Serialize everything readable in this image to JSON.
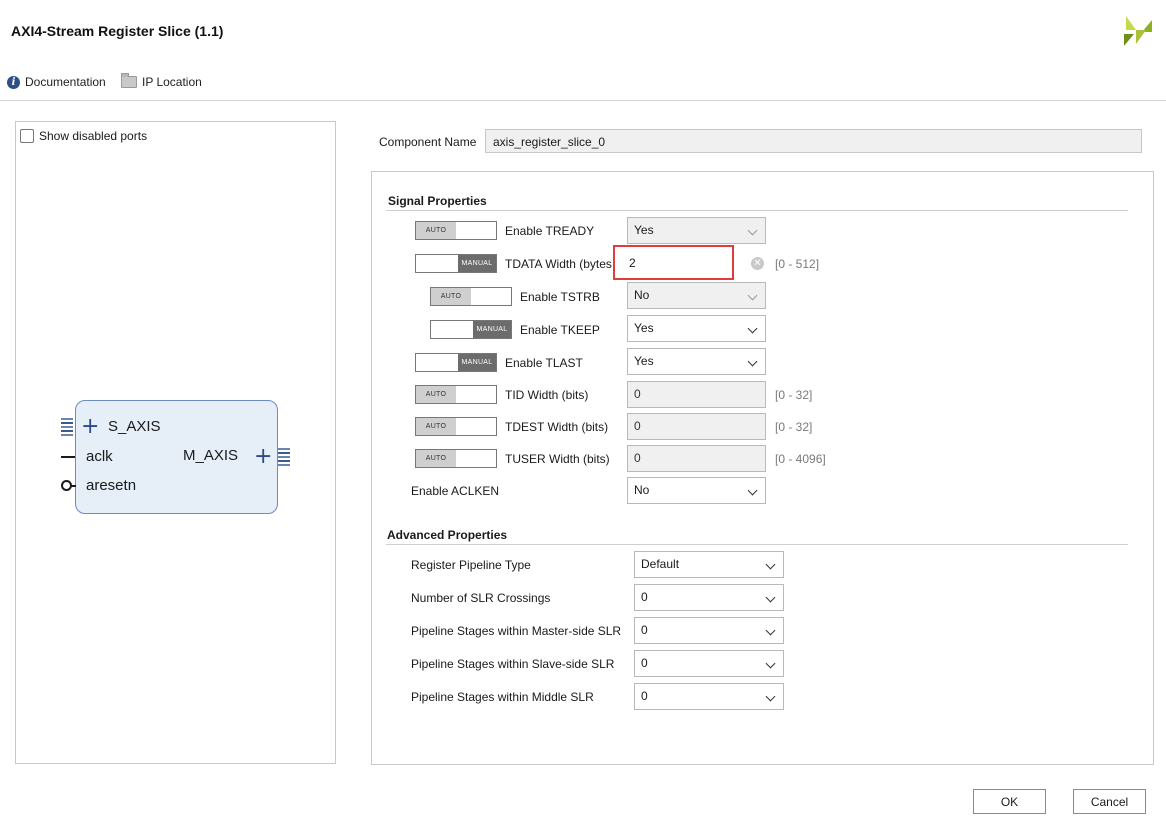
{
  "window": {
    "title": "AXI4-Stream Register Slice (1.1)"
  },
  "toolbar": {
    "documentation": "Documentation",
    "ip_location": "IP Location"
  },
  "symbol": {
    "show_disabled_ports": "Show disabled ports",
    "ports_left": [
      "S_AXIS",
      "aclk",
      "aresetn"
    ],
    "ports_right": [
      "M_AXIS"
    ]
  },
  "component": {
    "label": "Component Name",
    "value": "axis_register_slice_0"
  },
  "signal_properties": {
    "title": "Signal Properties",
    "rows": [
      {
        "mode": "AUTO",
        "label": "Enable TREADY",
        "value": "Yes",
        "kind": "select",
        "enabled": false,
        "range": ""
      },
      {
        "mode": "MANUAL",
        "label": "TDATA Width (bytes",
        "value": "2",
        "kind": "input",
        "enabled": true,
        "range": "[0 - 512]"
      },
      {
        "mode": "AUTO",
        "label": "Enable TSTRB",
        "value": "No",
        "kind": "select",
        "enabled": false,
        "range": ""
      },
      {
        "mode": "MANUAL",
        "label": "Enable TKEEP",
        "value": "Yes",
        "kind": "select",
        "enabled": true,
        "range": ""
      },
      {
        "mode": "MANUAL",
        "label": "Enable TLAST",
        "value": "Yes",
        "kind": "select",
        "enabled": true,
        "range": ""
      },
      {
        "mode": "AUTO",
        "label": "TID Width (bits)",
        "value": "0",
        "kind": "input",
        "enabled": false,
        "range": "[0 - 32]"
      },
      {
        "mode": "AUTO",
        "label": "TDEST Width (bits)",
        "value": "0",
        "kind": "input",
        "enabled": false,
        "range": "[0 - 32]"
      },
      {
        "mode": "AUTO",
        "label": "TUSER Width (bits)",
        "value": "0",
        "kind": "input",
        "enabled": false,
        "range": "[0 - 4096]"
      },
      {
        "mode": "",
        "label": "Enable ACLKEN",
        "value": "No",
        "kind": "select",
        "enabled": true,
        "range": ""
      }
    ]
  },
  "advanced_properties": {
    "title": "Advanced Properties",
    "rows": [
      {
        "label": "Register Pipeline Type",
        "value": "Default"
      },
      {
        "label": "Number of SLR Crossings",
        "value": "0"
      },
      {
        "label": "Pipeline Stages within Master-side SLR",
        "value": "0"
      },
      {
        "label": "Pipeline Stages within Slave-side SLR",
        "value": "0"
      },
      {
        "label": "Pipeline Stages within Middle SLR",
        "value": "0"
      }
    ]
  },
  "buttons": {
    "ok": "OK",
    "cancel": "Cancel"
  },
  "colors": {
    "highlight": "#e03c3c",
    "block_fill": "#e6eef8",
    "block_border": "#6b8cbf",
    "logo": "#8fb021"
  },
  "icons": {
    "documentation": "info-icon",
    "ip_location": "folder-icon",
    "logo": "xilinx-logo-icon",
    "clear": "clear-icon"
  }
}
